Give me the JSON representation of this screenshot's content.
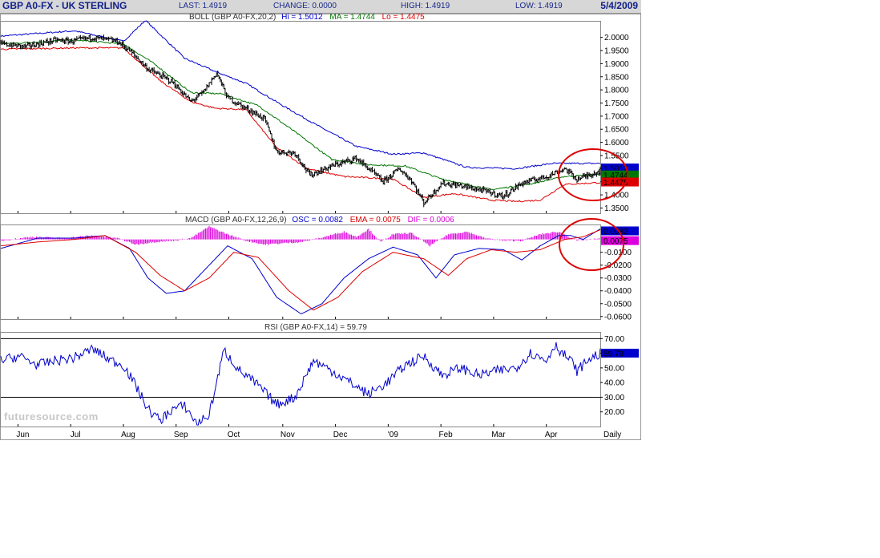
{
  "header": {
    "symbol": "GBP A0-FX - UK STERLING",
    "last": "LAST: 1.4919",
    "change": "CHANGE: 0.0000",
    "high": "HIGH: 1.4919",
    "low": "LOW: 1.4919",
    "date": "5/4/2009"
  },
  "panels": {
    "boll": {
      "prefix": "BOLL (GBP A0-FX,20,2)",
      "hi": "Hi = 1.5012",
      "ma": "MA = 1.4744",
      "lo": "Lo = 1.4475",
      "badge_hi": "1.5012",
      "badge_ma": "1.4744",
      "badge_lo": "1.4475"
    },
    "macd": {
      "prefix": "MACD (GBP A0-FX,12,26,9)",
      "osc": "OSC = 0.0082",
      "ema": "EMA = 0.0075",
      "dif": "DIF = 0.0006",
      "badge_osc": "0.0082",
      "badge_ema": "0.0075"
    },
    "rsi": {
      "title": "RSI (GBP A0-FX,14) = 59.79",
      "badge": "59.79"
    }
  },
  "x_axis": {
    "right_label": "Daily"
  },
  "watermark": "futuresource.com",
  "colors": {
    "header_bg": "#d7d7d7",
    "upper_band": "#0000cc",
    "middle_band": "#007700",
    "lower_band": "#dd0000",
    "macd_line": "#0000cc",
    "signal_line": "#dd0000",
    "histogram": "#dd00dd",
    "rsi_line": "#0000cc",
    "annotation_circle": "#dd0000"
  },
  "chart_data": [
    {
      "type": "line",
      "title": "BOLL (GBP A0-FX,20,2)",
      "subtype": "ohlc-bars with bollinger bands",
      "ylim": [
        1.33,
        2.06
      ],
      "yticks": [
        "2.0000",
        "1.9500",
        "1.9000",
        "1.8500",
        "1.8000",
        "1.7500",
        "1.7000",
        "1.6500",
        "1.6000",
        "1.5500",
        "1.5000",
        "1.4500",
        "1.4000",
        "1.3500"
      ],
      "x_ticks": [
        "Jun",
        "Jul",
        "Aug",
        "Sep",
        "Oct",
        "Nov",
        "Dec",
        "'09",
        "Feb",
        "Mar",
        "Apr"
      ],
      "x_tick_index": [
        14,
        57,
        100,
        143,
        186,
        230,
        273,
        316,
        359,
        402,
        445
      ],
      "x_range": [
        0,
        489
      ],
      "close_keypoints": [
        [
          0,
          1.975
        ],
        [
          20,
          1.965
        ],
        [
          45,
          1.99
        ],
        [
          57,
          1.985
        ],
        [
          75,
          2.0
        ],
        [
          95,
          1.985
        ],
        [
          105,
          1.95
        ],
        [
          120,
          1.88
        ],
        [
          140,
          1.83
        ],
        [
          155,
          1.755
        ],
        [
          165,
          1.79
        ],
        [
          176,
          1.865
        ],
        [
          185,
          1.77
        ],
        [
          200,
          1.73
        ],
        [
          215,
          1.69
        ],
        [
          225,
          1.565
        ],
        [
          240,
          1.56
        ],
        [
          252,
          1.475
        ],
        [
          270,
          1.51
        ],
        [
          290,
          1.54
        ],
        [
          300,
          1.5
        ],
        [
          312,
          1.45
        ],
        [
          325,
          1.5
        ],
        [
          335,
          1.455
        ],
        [
          345,
          1.37
        ],
        [
          360,
          1.445
        ],
        [
          375,
          1.435
        ],
        [
          390,
          1.42
        ],
        [
          410,
          1.395
        ],
        [
          425,
          1.445
        ],
        [
          445,
          1.47
        ],
        [
          460,
          1.5
        ],
        [
          470,
          1.46
        ],
        [
          489,
          1.492
        ]
      ],
      "series": [
        {
          "name": "Hi",
          "keypoints": [
            [
              0,
              2.005
            ],
            [
              60,
              2.025
            ],
            [
              100,
              1.985
            ],
            [
              118,
              2.065
            ],
            [
              150,
              1.92
            ],
            [
              175,
              1.87
            ],
            [
              200,
              1.825
            ],
            [
              230,
              1.74
            ],
            [
              260,
              1.66
            ],
            [
              290,
              1.585
            ],
            [
              320,
              1.555
            ],
            [
              345,
              1.56
            ],
            [
              380,
              1.505
            ],
            [
              420,
              1.5
            ],
            [
              450,
              1.52
            ],
            [
              489,
              1.52
            ]
          ]
        },
        {
          "name": "MA",
          "keypoints": [
            [
              0,
              1.975
            ],
            [
              60,
              1.99
            ],
            [
              100,
              1.975
            ],
            [
              125,
              1.9
            ],
            [
              155,
              1.79
            ],
            [
              180,
              1.785
            ],
            [
              210,
              1.74
            ],
            [
              240,
              1.64
            ],
            [
              270,
              1.535
            ],
            [
              300,
              1.515
            ],
            [
              330,
              1.51
            ],
            [
              360,
              1.46
            ],
            [
              400,
              1.42
            ],
            [
              430,
              1.44
            ],
            [
              460,
              1.47
            ],
            [
              489,
              1.478
            ]
          ]
        },
        {
          "name": "Lo",
          "keypoints": [
            [
              0,
              1.955
            ],
            [
              60,
              1.96
            ],
            [
              100,
              1.96
            ],
            [
              130,
              1.835
            ],
            [
              155,
              1.755
            ],
            [
              175,
              1.73
            ],
            [
              200,
              1.725
            ],
            [
              225,
              1.58
            ],
            [
              250,
              1.5
            ],
            [
              280,
              1.47
            ],
            [
              320,
              1.46
            ],
            [
              345,
              1.39
            ],
            [
              370,
              1.405
            ],
            [
              400,
              1.38
            ],
            [
              420,
              1.375
            ],
            [
              440,
              1.38
            ],
            [
              460,
              1.44
            ],
            [
              489,
              1.447
            ]
          ]
        }
      ],
      "current": {
        "hi": 1.5012,
        "ma": 1.4744,
        "lo": 1.4475
      }
    },
    {
      "type": "line",
      "title": "MACD (GBP A0-FX,12,26,9)",
      "ylim": [
        -0.062,
        0.011
      ],
      "yticks": [
        "-0.0100",
        "-0.0200",
        "-0.0300",
        "-0.0400",
        "-0.0500",
        "-0.0600"
      ],
      "x_range": [
        0,
        489
      ],
      "series": [
        {
          "name": "OSC",
          "keypoints": [
            [
              0,
              -0.007
            ],
            [
              30,
              0.001
            ],
            [
              60,
              0.001
            ],
            [
              85,
              0.003
            ],
            [
              105,
              -0.007
            ],
            [
              120,
              -0.03
            ],
            [
              135,
              -0.042
            ],
            [
              150,
              -0.04
            ],
            [
              165,
              -0.025
            ],
            [
              185,
              -0.005
            ],
            [
              205,
              -0.015
            ],
            [
              225,
              -0.045
            ],
            [
              245,
              -0.058
            ],
            [
              262,
              -0.05
            ],
            [
              280,
              -0.03
            ],
            [
              300,
              -0.015
            ],
            [
              320,
              -0.006
            ],
            [
              340,
              -0.012
            ],
            [
              355,
              -0.03
            ],
            [
              370,
              -0.012
            ],
            [
              390,
              -0.007
            ],
            [
              410,
              -0.008
            ],
            [
              425,
              -0.016
            ],
            [
              440,
              -0.005
            ],
            [
              455,
              0.003
            ],
            [
              465,
              0.003
            ],
            [
              475,
              0.0
            ],
            [
              489,
              0.0082
            ]
          ]
        },
        {
          "name": "EMA",
          "keypoints": [
            [
              0,
              -0.005
            ],
            [
              30,
              -0.002
            ],
            [
              60,
              0.0
            ],
            [
              85,
              0.003
            ],
            [
              110,
              -0.01
            ],
            [
              130,
              -0.028
            ],
            [
              150,
              -0.04
            ],
            [
              170,
              -0.03
            ],
            [
              190,
              -0.01
            ],
            [
              210,
              -0.014
            ],
            [
              235,
              -0.04
            ],
            [
              255,
              -0.055
            ],
            [
              275,
              -0.045
            ],
            [
              295,
              -0.025
            ],
            [
              320,
              -0.01
            ],
            [
              345,
              -0.015
            ],
            [
              365,
              -0.028
            ],
            [
              380,
              -0.015
            ],
            [
              400,
              -0.008
            ],
            [
              420,
              -0.01
            ],
            [
              440,
              -0.008
            ],
            [
              460,
              0.0
            ],
            [
              475,
              0.002
            ],
            [
              489,
              0.0075
            ]
          ]
        }
      ],
      "histogram": {
        "name": "DIF",
        "keypoints": [
          [
            0,
            -0.001
          ],
          [
            25,
            0.002
          ],
          [
            50,
            0.001
          ],
          [
            75,
            0.003
          ],
          [
            95,
            0.001
          ],
          [
            110,
            -0.004
          ],
          [
            125,
            -0.002
          ],
          [
            140,
            -0.001
          ],
          [
            155,
            0.001
          ],
          [
            170,
            0.01
          ],
          [
            185,
            0.004
          ],
          [
            200,
            -0.001
          ],
          [
            215,
            -0.004
          ],
          [
            230,
            -0.003
          ],
          [
            245,
            -0.002
          ],
          [
            260,
            0.001
          ],
          [
            280,
            0.006
          ],
          [
            290,
            0.002
          ],
          [
            300,
            0.008
          ],
          [
            310,
            -0.002
          ],
          [
            320,
            0.004
          ],
          [
            335,
            0.005
          ],
          [
            350,
            -0.005
          ],
          [
            365,
            0.004
          ],
          [
            380,
            0.006
          ],
          [
            395,
            0.001
          ],
          [
            410,
            -0.001
          ],
          [
            425,
            -0.001
          ],
          [
            440,
            0.004
          ],
          [
            455,
            0.006
          ],
          [
            470,
            -0.001
          ],
          [
            489,
            0.0006
          ]
        ]
      }
    },
    {
      "type": "line",
      "title": "RSI (GBP A0-FX,14)",
      "ylim": [
        10,
        74
      ],
      "yticks": [
        "70.00",
        "60.00",
        "50.00",
        "40.00",
        "30.00",
        "20.00"
      ],
      "reference_lines": [
        70,
        30
      ],
      "x_range": [
        0,
        489
      ],
      "series": [
        {
          "name": "RSI",
          "keypoints": [
            [
              0,
              55
            ],
            [
              15,
              58
            ],
            [
              30,
              52
            ],
            [
              45,
              55
            ],
            [
              60,
              57
            ],
            [
              75,
              63
            ],
            [
              90,
              55
            ],
            [
              100,
              52
            ],
            [
              110,
              38
            ],
            [
              120,
              22
            ],
            [
              130,
              14
            ],
            [
              140,
              22
            ],
            [
              150,
              24
            ],
            [
              160,
              12
            ],
            [
              170,
              18
            ],
            [
              182,
              62
            ],
            [
              195,
              48
            ],
            [
              210,
              38
            ],
            [
              225,
              25
            ],
            [
              240,
              30
            ],
            [
              255,
              55
            ],
            [
              270,
              48
            ],
            [
              285,
              40
            ],
            [
              300,
              32
            ],
            [
              315,
              40
            ],
            [
              330,
              52
            ],
            [
              345,
              58
            ],
            [
              360,
              45
            ],
            [
              375,
              50
            ],
            [
              390,
              45
            ],
            [
              405,
              48
            ],
            [
              420,
              50
            ],
            [
              432,
              60
            ],
            [
              445,
              55
            ],
            [
              452,
              66
            ],
            [
              458,
              60
            ],
            [
              465,
              55
            ],
            [
              470,
              48
            ],
            [
              480,
              56
            ],
            [
              489,
              59.79
            ]
          ]
        }
      ],
      "current": 59.79
    }
  ]
}
